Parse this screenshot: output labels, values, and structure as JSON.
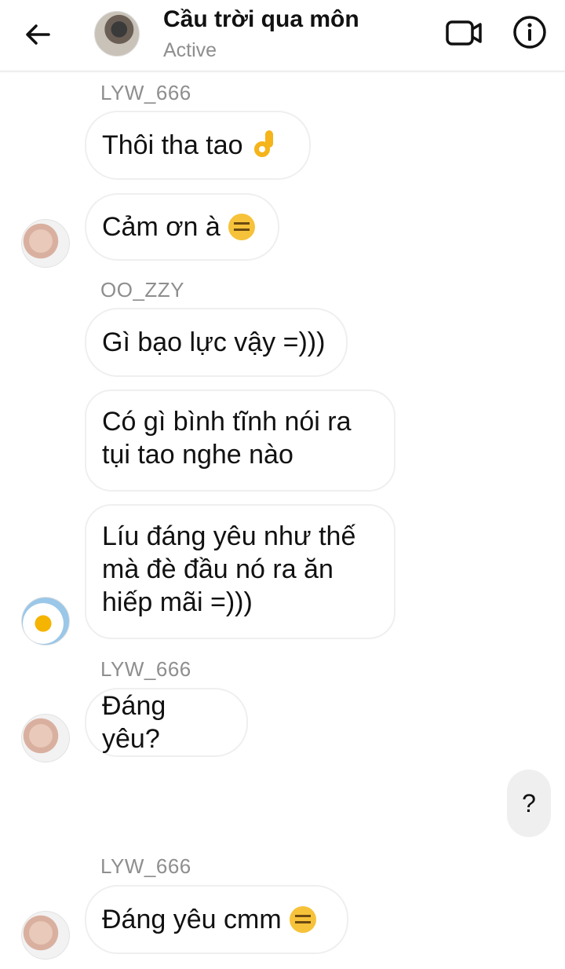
{
  "header": {
    "contact_name": "Cầu trời qua môn",
    "status": "Active"
  },
  "icons": {
    "back": "arrow-left-icon",
    "video": "video-camera-icon",
    "info": "info-icon"
  },
  "messages": [
    {
      "sender": "LYW_666",
      "text": "Thôi tha tao",
      "emoji": "ok-hand"
    },
    {
      "text": "Cảm ơn à",
      "emoji": "expressionless-face"
    },
    {
      "sender": "OO_ZZY",
      "text": "Gì bạo lực vậy =)))"
    },
    {
      "line1": "Có gì bình tĩnh nói ra",
      "line2": "tụi tao nghe nào"
    },
    {
      "line1": "Líu đáng yêu như thế",
      "line2": "mà đè đầu nó ra ăn",
      "line3": "hiếp mãi =)))"
    },
    {
      "sender": "LYW_666",
      "text": "Đáng yêu?"
    },
    {
      "text": "?",
      "outgoing": true
    },
    {
      "sender": "LYW_666",
      "text": "Đáng yêu cmm",
      "emoji": "expressionless-face"
    }
  ],
  "colors": {
    "bubble_border": "#efefef",
    "outgoing_bubble": "#efefef",
    "secondary_text": "#8e8e8e"
  }
}
